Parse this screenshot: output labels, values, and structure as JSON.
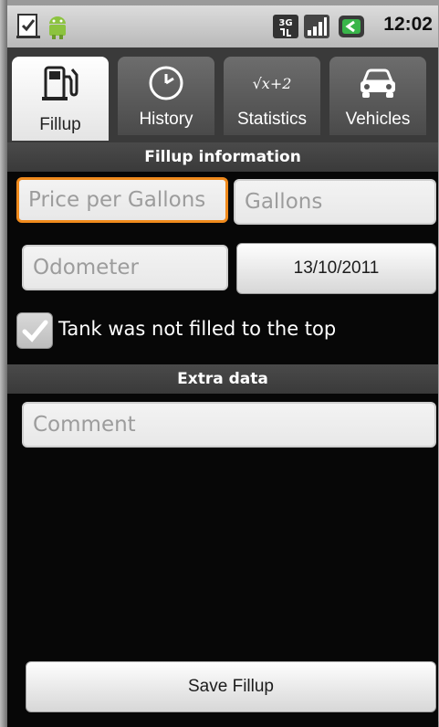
{
  "status_bar": {
    "time": "12:02",
    "icons": [
      "sd-card-icon",
      "android-icon",
      "3g-data-icon",
      "signal-bars-icon",
      "battery-icon"
    ]
  },
  "tabs": [
    {
      "label": "Fillup",
      "icon": "fuel-pump-icon",
      "active": true
    },
    {
      "label": "History",
      "icon": "clock-icon",
      "active": false
    },
    {
      "label": "Statistics",
      "icon": "sqrt-formula-icon",
      "icon_text": "√x+2",
      "active": false
    },
    {
      "label": "Vehicles",
      "icon": "car-icon",
      "active": false
    }
  ],
  "fillup_section": {
    "title": "Fillup information",
    "price_placeholder": "Price per Gallons",
    "gallons_placeholder": "Gallons",
    "odometer_placeholder": "Odometer",
    "date": "13/10/2011",
    "not_full_label": "Tank was not filled to the top",
    "not_full_checked": true
  },
  "extra_section": {
    "title": "Extra data",
    "comment_placeholder": "Comment"
  },
  "save_button": "Save Fillup",
  "colors": {
    "focus_border": "#f08a1c",
    "background": "#070707",
    "section_header": "#404040"
  }
}
